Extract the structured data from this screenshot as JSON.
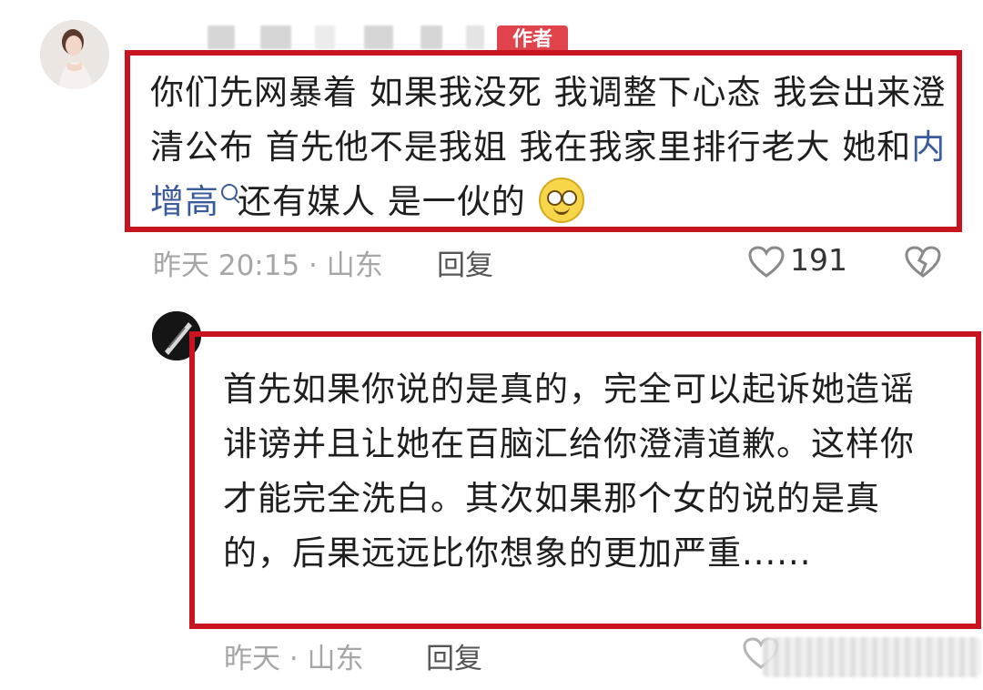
{
  "comment": {
    "author_badge": "作者",
    "text_before_link": "你们先网暴着 如果我没死 我调整下心态 我会出来澄清公布 首先他不是我姐 我在我家里排行老大 她和",
    "link_text": "内增高",
    "text_after_link": "还有媒人 是一伙的",
    "meta": "昨天 20:15 · 山东",
    "reply_label": "回复",
    "like_count": "191"
  },
  "reply": {
    "text": "首先如果你说的是真的，完全可以起诉她造谣诽谤并且让她在百脑汇给你澄清道歉。这样你才能完全洗白。其次如果那个女的说的是真的，后果远远比你想象的更加严重......",
    "meta": "昨天 · 山东",
    "reply_label": "回复"
  },
  "icons": {
    "like": "heart-outline-icon",
    "dislike": "broken-heart-icon",
    "link_search": "search-icon",
    "emoji": "dizzy-smile-emoji-icon"
  },
  "colors": {
    "highlight_border": "#c8141e",
    "author_badge": "#e1434d",
    "link": "#3b5a9b",
    "meta_text": "#a6a6a6"
  }
}
